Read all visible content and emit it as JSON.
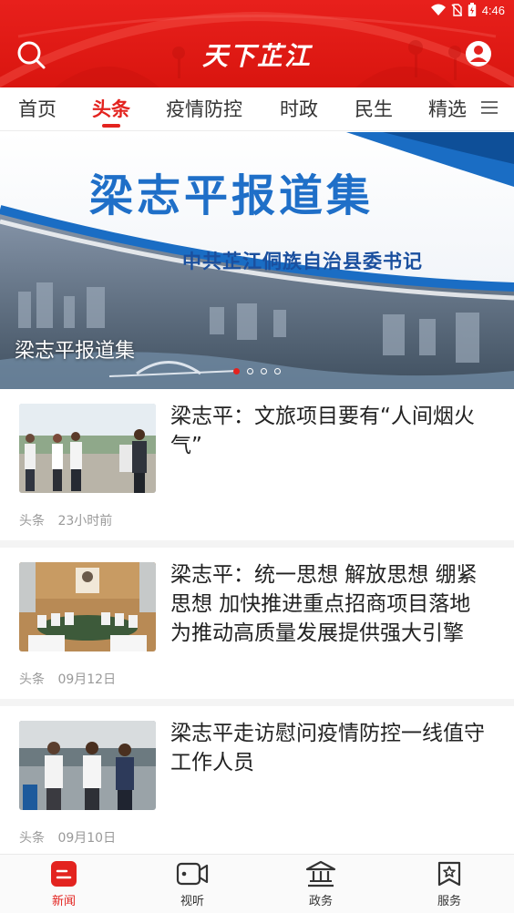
{
  "status_bar": {
    "time": "4:46"
  },
  "header": {
    "app_title": "天下芷江"
  },
  "tabs": [
    {
      "label": "首页",
      "active": false
    },
    {
      "label": "头条",
      "active": true
    },
    {
      "label": "疫情防控",
      "active": false
    },
    {
      "label": "时政",
      "active": false
    },
    {
      "label": "民生",
      "active": false
    },
    {
      "label": "精选",
      "active": false
    }
  ],
  "banner": {
    "title": "梁志平报道集",
    "subtitle": "中共芷江侗族自治县委书记",
    "caption": "梁志平报道集",
    "slide_count": 4,
    "active_slide": 1
  },
  "news": [
    {
      "title": "梁志平：文旅项目要有“人间烟火气”",
      "category": "头条",
      "time": "23小时前"
    },
    {
      "title": "梁志平：统一思想 解放思想 绷紧思想 加快推进重点招商项目落地为推动高质量发展提供强大引擎",
      "category": "头条",
      "time": "09月12日"
    },
    {
      "title": "梁志平走访慰问疫情防控一线值守工作人员",
      "category": "头条",
      "time": "09月10日"
    }
  ],
  "bottom_nav": [
    {
      "label": "新闻",
      "icon": "news-icon",
      "active": true
    },
    {
      "label": "视听",
      "icon": "video-icon",
      "active": false
    },
    {
      "label": "政务",
      "icon": "government-icon",
      "active": false
    },
    {
      "label": "服务",
      "icon": "service-icon",
      "active": false
    }
  ],
  "colors": {
    "brand_red": "#e3231f",
    "banner_title_blue": "#1f6fc8"
  }
}
